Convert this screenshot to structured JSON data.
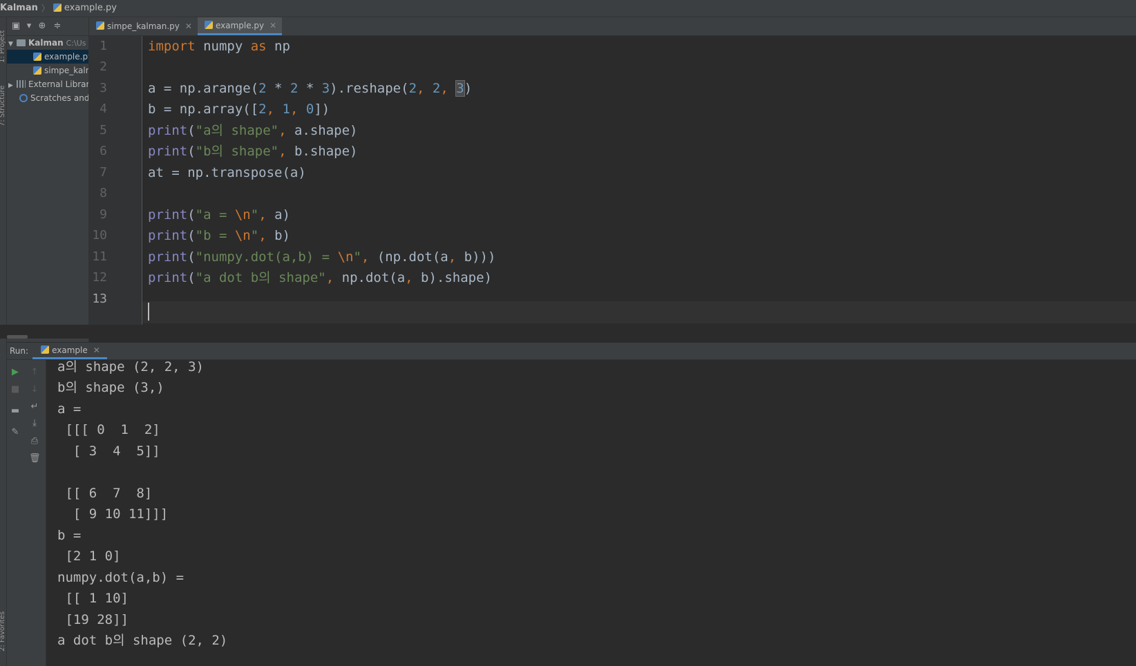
{
  "breadcrumb": {
    "project": "Kalman",
    "file": "example.py"
  },
  "side_tabs": {
    "project": "1: Project",
    "structure": "7: Structure",
    "favorites": "2: Favorites"
  },
  "project_tree": {
    "root": {
      "label": "Kalman",
      "path": "C:\\Us"
    },
    "items": [
      {
        "label": "example.py",
        "selected": true
      },
      {
        "label": "simpe_kalm",
        "selected": false
      }
    ],
    "external": "External Librari",
    "scratches": "Scratches and"
  },
  "editor_tabs": [
    {
      "label": "simpe_kalman.py",
      "close": "✕",
      "active": false
    },
    {
      "label": "example.py",
      "close": "✕",
      "active": true
    }
  ],
  "line_numbers": [
    "1",
    "2",
    "3",
    "4",
    "5",
    "6",
    "7",
    "8",
    "9",
    "10",
    "11",
    "12",
    "13"
  ],
  "current_line": "13",
  "run": {
    "label": "Run:",
    "tab": "example",
    "close": "✕",
    "output": [
      "a의 shape (2, 2, 3)",
      "b의 shape (3,)",
      "a =",
      " [[[ 0  1  2]",
      "  [ 3  4  5]]",
      "",
      " [[ 6  7  8]",
      "  [ 9 10 11]]]",
      "b =",
      " [2 1 0]",
      "numpy.dot(a,b) =",
      " [[ 1 10]",
      " [19 28]]",
      "a dot b의 shape (2, 2)"
    ]
  },
  "colors": {
    "keyword": "#cc7832",
    "string": "#6a8759",
    "number": "#6897bb",
    "builtin": "#8888c6",
    "text": "#a9b7c6",
    "background": "#2b2b2b"
  }
}
